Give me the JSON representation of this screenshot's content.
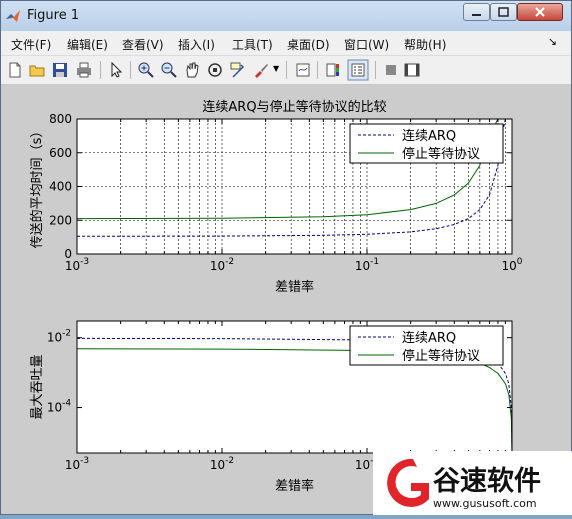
{
  "window": {
    "title": "Figure 1"
  },
  "menu": [
    "文件(F)",
    "编辑(E)",
    "查看(V)",
    "插入(I)",
    "工具(T)",
    "桌面(D)",
    "窗口(W)",
    "帮助(H)"
  ],
  "toolbar_icons": [
    "new-file-icon",
    "open-folder-icon",
    "save-icon",
    "print-icon",
    "pointer-icon",
    "zoom-in-icon",
    "zoom-out-icon",
    "pan-icon",
    "rotate-3d-icon",
    "data-cursor-icon",
    "brush-icon",
    "link-icon",
    "colorbar-icon",
    "legend-icon",
    "hide-plot-tools-icon",
    "show-plot-tools-icon"
  ],
  "chart_data": [
    {
      "type": "line",
      "title": "连续ARQ与停止等待协议的比较",
      "xlabel": "差错率",
      "ylabel": "传送的平均时间（s）",
      "xscale": "log",
      "xlim": [
        0.001,
        1
      ],
      "ylim": [
        0,
        800
      ],
      "xticklabels": [
        "10",
        "10",
        "10",
        "10"
      ],
      "xtick_exponents": [
        "-3",
        "-2",
        "-1",
        "0"
      ],
      "yticks": [
        "0",
        "200",
        "400",
        "600",
        "800"
      ],
      "grid": true,
      "legend_position": "top-right",
      "series": [
        {
          "name": "连续ARQ",
          "style": "dashed",
          "color": "#00008b",
          "x": [
            0.001,
            0.01,
            0.05,
            0.1,
            0.2,
            0.3,
            0.4,
            0.5,
            0.6,
            0.7,
            0.8,
            0.85,
            0.9,
            0.95
          ],
          "y": [
            105,
            106,
            111,
            117,
            131,
            150,
            175,
            210,
            263,
            350,
            525,
            700,
            800,
            800
          ]
        },
        {
          "name": "停止等待协议",
          "style": "solid",
          "color": "#006400",
          "x": [
            0.001,
            0.01,
            0.05,
            0.1,
            0.2,
            0.3,
            0.4,
            0.5,
            0.6,
            0.7,
            0.8,
            0.85,
            0.9
          ],
          "y": [
            210,
            212,
            221,
            233,
            263,
            300,
            350,
            420,
            525,
            700,
            800,
            800,
            800
          ]
        }
      ]
    },
    {
      "type": "line",
      "title": "",
      "xlabel": "差错率",
      "ylabel": "最大吞吐量",
      "xscale": "log",
      "yscale": "log",
      "xlim": [
        0.001,
        1
      ],
      "ylim": [
        5e-06,
        0.03
      ],
      "xticklabels": [
        "10",
        "10",
        "10",
        "10"
      ],
      "xtick_exponents": [
        "-3",
        "-2",
        "-1",
        "0"
      ],
      "yticklabels": [
        "10",
        "10"
      ],
      "ytick_exponents": [
        "-2",
        "-4"
      ],
      "grid": false,
      "legend_position": "top-right",
      "series": [
        {
          "name": "连续ARQ",
          "style": "dashed",
          "color": "#00008b",
          "x": [
            0.001,
            0.01,
            0.1,
            0.2,
            0.3,
            0.4,
            0.5,
            0.6,
            0.7,
            0.8,
            0.9,
            0.95,
            0.99,
            0.999
          ],
          "y": [
            0.0095,
            0.0094,
            0.0086,
            0.0076,
            0.0067,
            0.0057,
            0.0048,
            0.0038,
            0.0029,
            0.0019,
            0.00095,
            0.00048,
            9.5e-05,
            9.5e-06
          ]
        },
        {
          "name": "停止等待协议",
          "style": "solid",
          "color": "#006400",
          "x": [
            0.001,
            0.01,
            0.1,
            0.2,
            0.3,
            0.4,
            0.5,
            0.6,
            0.7,
            0.8,
            0.9,
            0.95,
            0.99,
            0.999
          ],
          "y": [
            0.0048,
            0.0047,
            0.0043,
            0.0038,
            0.0033,
            0.0029,
            0.0024,
            0.0019,
            0.0014,
            0.00095,
            0.00048,
            0.00024,
            4.8e-05,
            4.8e-06
          ]
        }
      ]
    }
  ],
  "watermark": {
    "brand": "谷速软件",
    "url": "www.gususoft.com",
    "accent": "#e0242a"
  }
}
